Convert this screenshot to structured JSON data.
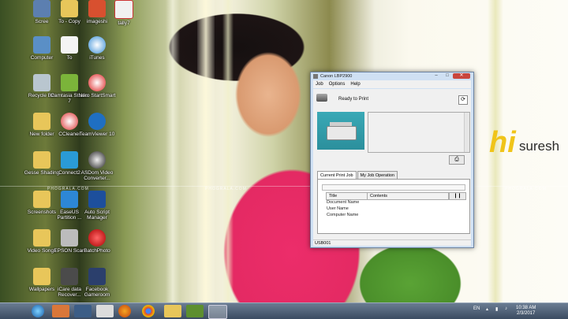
{
  "desktop": {
    "brand_big": "hi",
    "brand_name": "suresh",
    "watermark": "PHOGRALA.COM",
    "icons": [
      {
        "label": "Scree"
      },
      {
        "label": "To - Copy"
      },
      {
        "label": "imageshi"
      },
      {
        "label": "tally7"
      },
      {
        "label": "Computer"
      },
      {
        "label": "To"
      },
      {
        "label": "iTunes"
      },
      {
        "label": "Recycle Bin"
      },
      {
        "label": "Camtasia Studio 7"
      },
      {
        "label": "Nero StartSmart"
      },
      {
        "label": "New folder"
      },
      {
        "label": "CCleaner"
      },
      {
        "label": "TeamViewer 10"
      },
      {
        "label": "Gesse Shading"
      },
      {
        "label": "Connect2"
      },
      {
        "label": "ASDom Video Converter..."
      },
      {
        "label": "Screenshots"
      },
      {
        "label": "EaseUS Partition ..."
      },
      {
        "label": "Auto Script Manager"
      },
      {
        "label": "Video Songs"
      },
      {
        "label": "EPSON Scan"
      },
      {
        "label": "BatchPhoto"
      },
      {
        "label": "Wallpapers"
      },
      {
        "label": "iCare data Recover..."
      },
      {
        "label": "Facebook Gameroom"
      }
    ]
  },
  "window": {
    "title": "Canon LBP2900",
    "controls": {
      "min": "–",
      "max": "□",
      "close": "✕"
    },
    "menu": [
      "Job",
      "Options",
      "Help"
    ],
    "status": "Ready to Print",
    "tabs": [
      "Current Print Job",
      "My Job Operation"
    ],
    "columns": [
      "Title",
      "Contents"
    ],
    "fields": [
      "Document Name",
      "User Name",
      "Computer Name"
    ],
    "statusbar": "USB001"
  },
  "taskbar": {
    "lang": "EN",
    "time": "10:38 AM",
    "date": "2/3/2017"
  }
}
